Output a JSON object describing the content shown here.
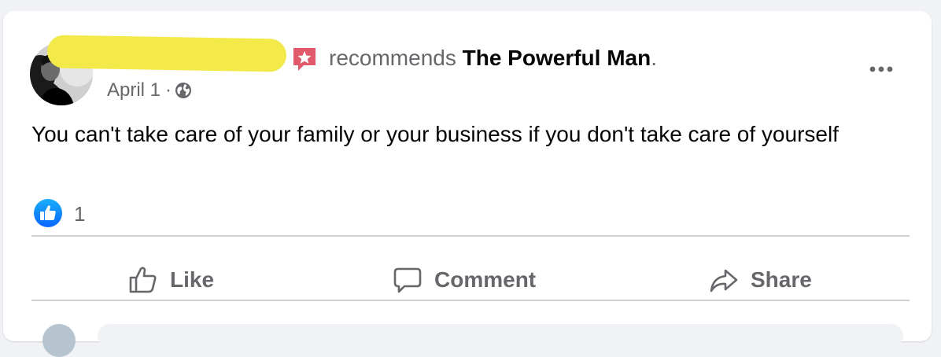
{
  "post": {
    "action_text": "recommends",
    "page_name": "The Powerful Man",
    "page_suffix": ".",
    "date": "April 1",
    "separator": "·",
    "body": "You can't take care of your family or your business if you don't take care of yourself",
    "reaction_count": "1"
  },
  "actions": {
    "like": "Like",
    "comment": "Comment",
    "share": "Share"
  },
  "icons": {
    "recommend": "star-badge-icon",
    "privacy": "globe-icon",
    "more": "more-options-icon",
    "reaction": "thumbs-up-reaction-icon"
  },
  "colors": {
    "page_bg": "#f0f2f5",
    "text_primary": "#050505",
    "text_secondary": "#65676b",
    "recommend_red": "#e05a6b",
    "like_blue": "#1877f2",
    "redaction": "#f3ea4a"
  }
}
